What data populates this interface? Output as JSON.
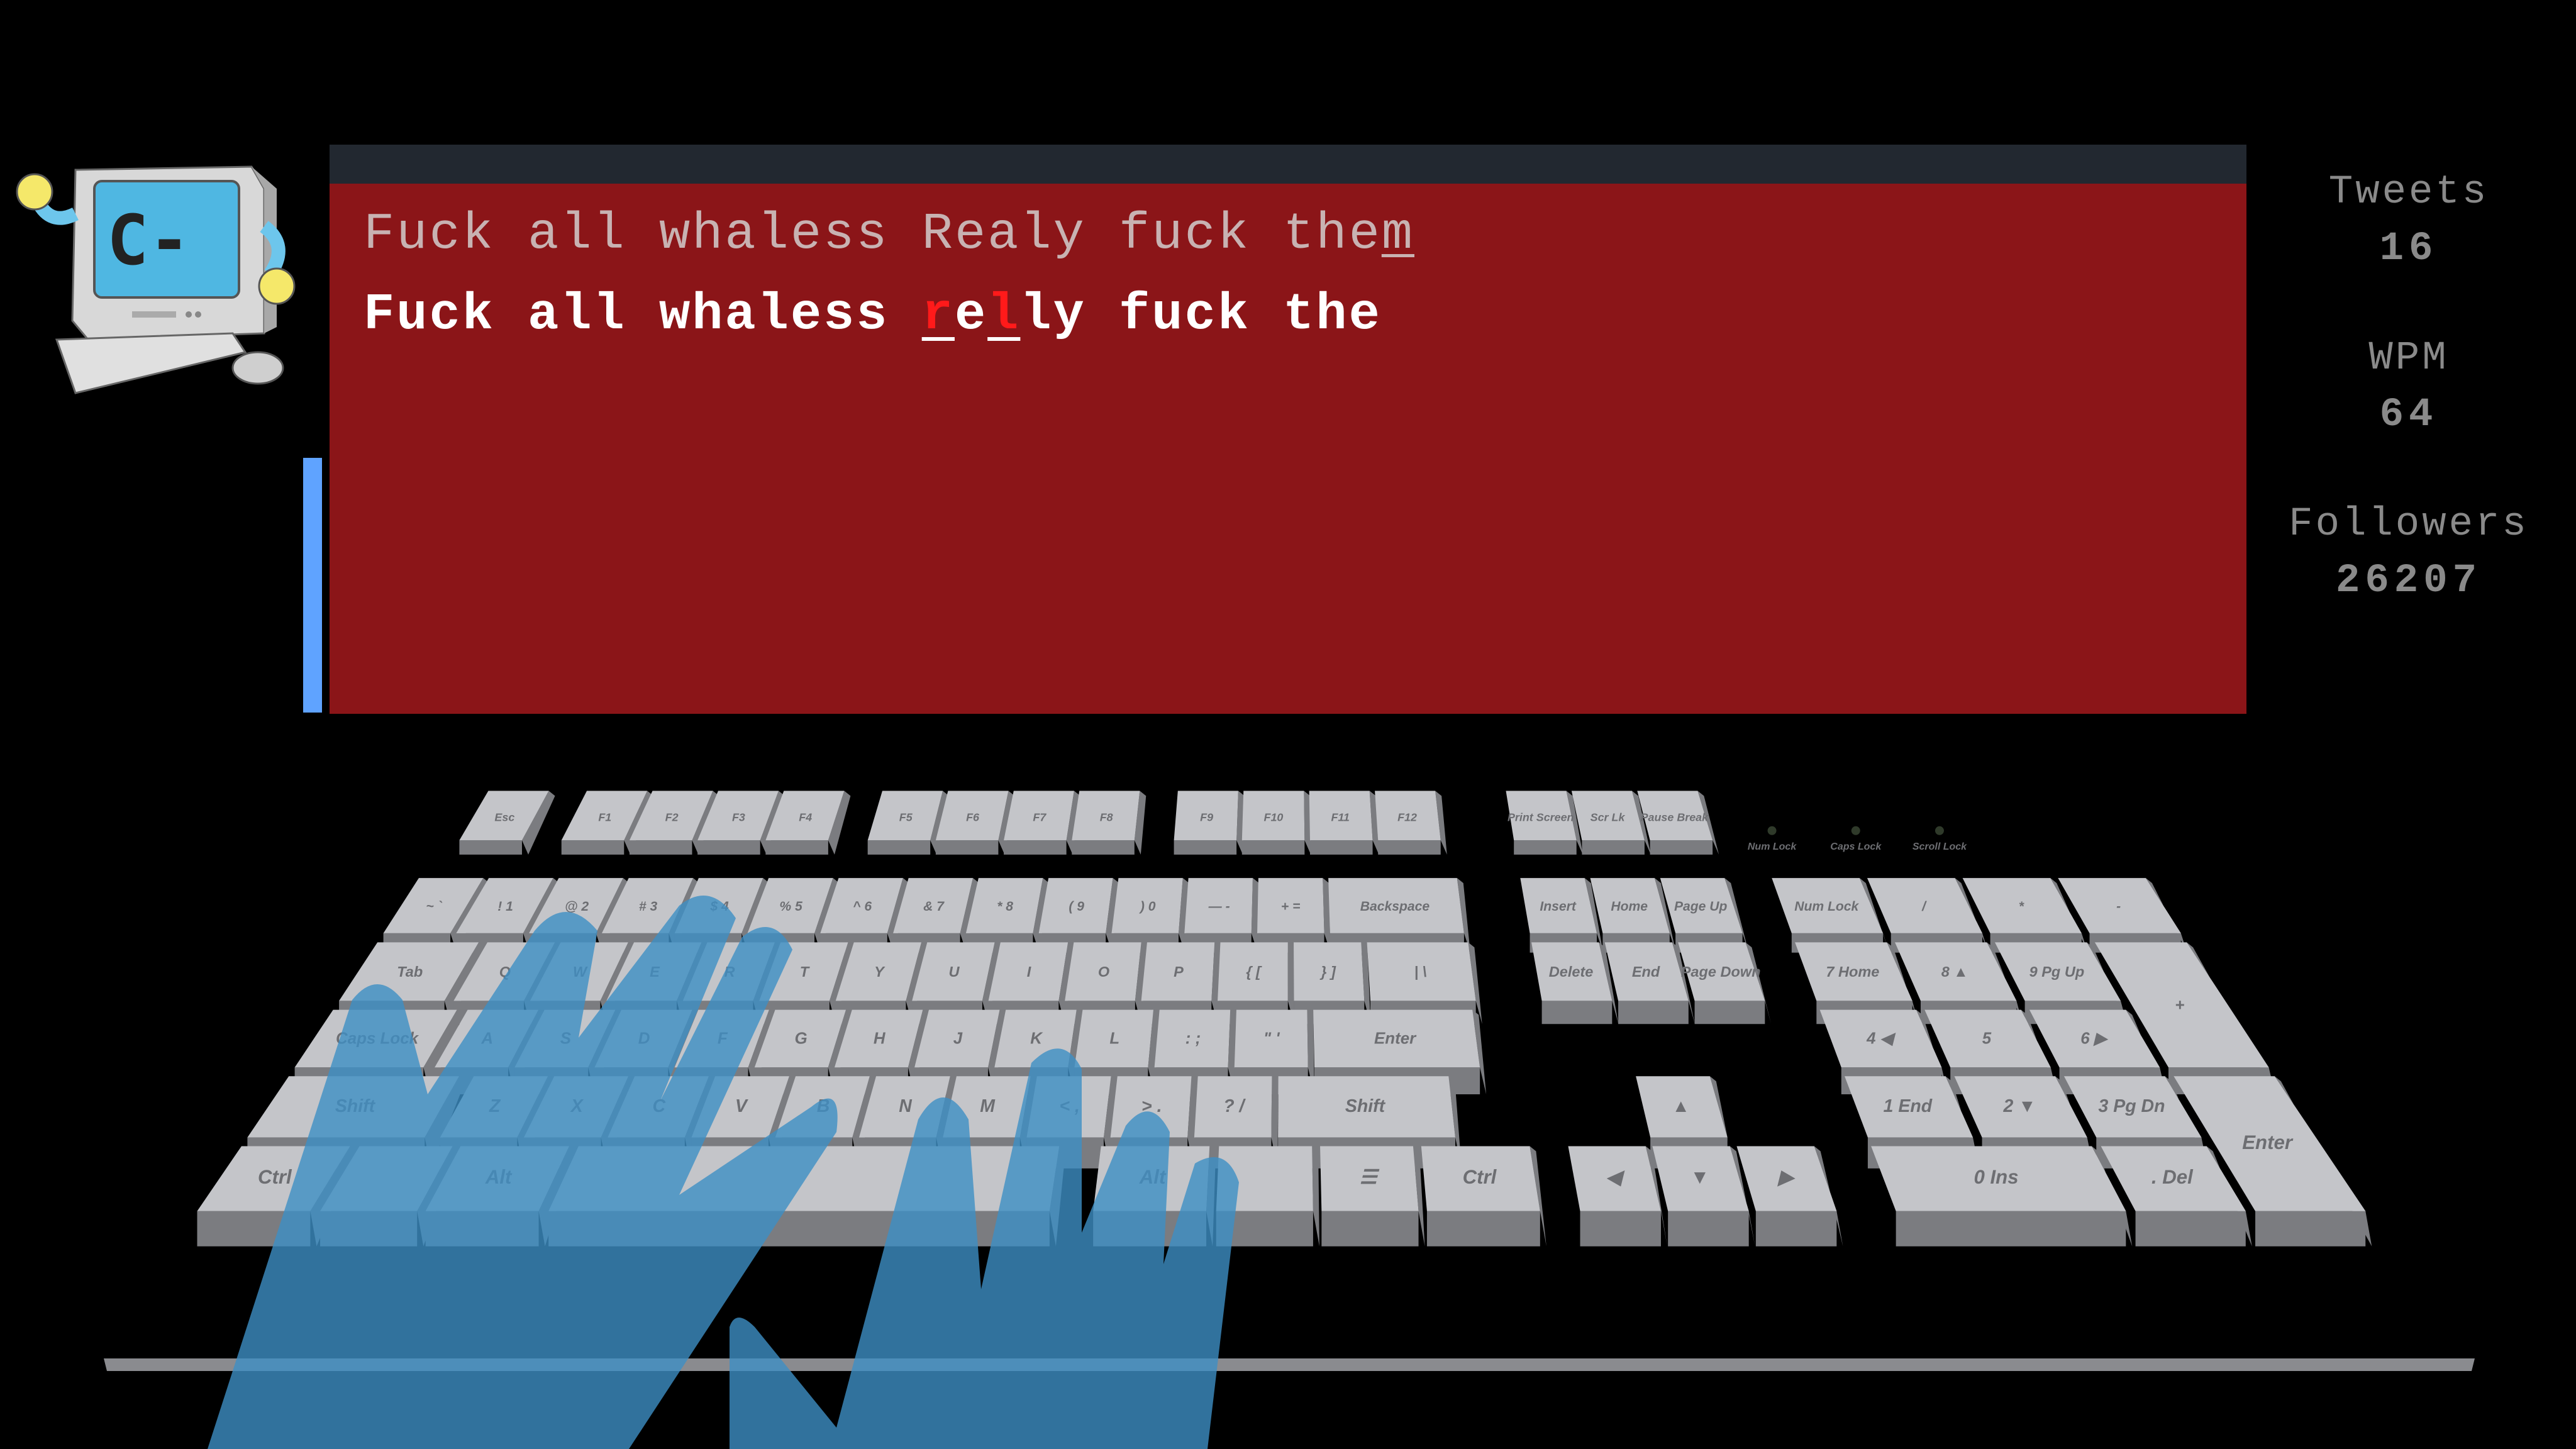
{
  "app": {
    "mascot_screen_text": "C-"
  },
  "progress": {
    "fraction": 0.72,
    "color": "#5fa3ff"
  },
  "panel": {
    "target_text": "Fuck all whaless Realy fuck them",
    "target_cursor_index": 31,
    "typed_text": "Fuck all whaless relly fuck the",
    "typed_error_indices": [
      17,
      19
    ],
    "background": "#8b1518",
    "header_color": "#222830"
  },
  "stats": [
    {
      "label": "Tweets",
      "value": "16"
    },
    {
      "label": "WPM",
      "value": "64"
    },
    {
      "label": "Followers",
      "value": "26207"
    }
  ],
  "keyboard": {
    "function_row": [
      "Esc",
      "F1",
      "F2",
      "F3",
      "F4",
      "F5",
      "F6",
      "F7",
      "F8",
      "F9",
      "F10",
      "F11",
      "F12"
    ],
    "system_keys": [
      "Print Screen",
      "Scr Lk",
      "Pause Break"
    ],
    "indicators": [
      "Num Lock",
      "Caps Lock",
      "Scroll Lock"
    ],
    "number_row": [
      [
        "~",
        "`"
      ],
      [
        "!",
        "1"
      ],
      [
        "@",
        "2"
      ],
      [
        "#",
        "3"
      ],
      [
        "$",
        "4"
      ],
      [
        "%",
        "5"
      ],
      [
        "^",
        "6"
      ],
      [
        "&",
        "7"
      ],
      [
        "*",
        "8"
      ],
      [
        "(",
        "9"
      ],
      [
        ")",
        "0"
      ],
      [
        "—",
        "-"
      ],
      [
        "+",
        "="
      ],
      [
        "",
        "Backspace"
      ]
    ],
    "top_row": [
      "Tab",
      "Q",
      "W",
      "E",
      "R",
      "T",
      "Y",
      "U",
      "I",
      "O",
      "P",
      "{ [",
      "} ]",
      "| \\"
    ],
    "home_row": [
      "Caps Lock",
      "A",
      "S",
      "D",
      "F",
      "G",
      "H",
      "J",
      "K",
      "L",
      ": ;",
      "\" '",
      "Enter"
    ],
    "bottom_row": [
      "Shift",
      "Z",
      "X",
      "C",
      "V",
      "B",
      "N",
      "M",
      "< ,",
      "> .",
      "? /",
      "Shift"
    ],
    "space_row": [
      "Ctrl",
      "",
      "Alt",
      "",
      "Alt",
      "",
      "menu",
      "Ctrl"
    ],
    "nav_keys": [
      "Insert",
      "Home",
      "Page Up",
      "Delete",
      "End",
      "Page Down"
    ],
    "arrow_keys": [
      "▲",
      "◀",
      "▼",
      "▶"
    ],
    "numpad": [
      [
        "Num Lock",
        "/",
        "*",
        "-"
      ],
      [
        "7 Home",
        "8 ▲",
        "9 Pg Up",
        "+"
      ],
      [
        "4 ◀",
        "5",
        "6 ▶"
      ],
      [
        "1 End",
        "2 ▼",
        "3 Pg Dn",
        "Enter"
      ],
      [
        "0 Ins",
        ". Del"
      ]
    ]
  },
  "hands": {
    "color": "#3d8fc4",
    "opacity": 0.8
  }
}
